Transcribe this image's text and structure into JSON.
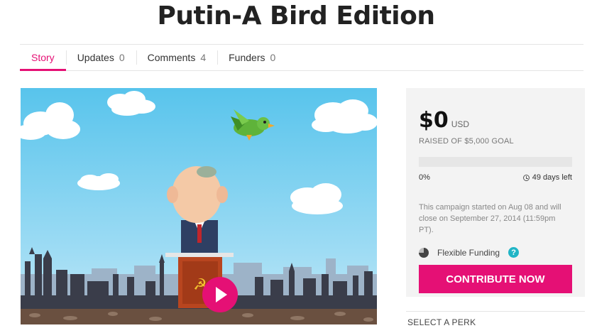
{
  "page": {
    "title": "Putin-A Bird Edition"
  },
  "tabs": [
    {
      "label": "Story",
      "count": ""
    },
    {
      "label": "Updates",
      "count": "0"
    },
    {
      "label": "Comments",
      "count": "4"
    },
    {
      "label": "Funders",
      "count": "0"
    }
  ],
  "video": {
    "play_icon": "play-icon",
    "progress_fraction": 0
  },
  "campaign": {
    "amount": "$0",
    "currency": "USD",
    "goal_text": "RAISED OF $5,000 GOAL",
    "progress_percent": 0,
    "percent_label": "0%",
    "days_left": "49 days left",
    "note": "This campaign started on Aug 08 and will close on September 27, 2014 (11:59pm PT).",
    "funding_type": "Flexible Funding",
    "help_glyph": "?",
    "contribute_label": "CONTRIBUTE NOW"
  },
  "perks": {
    "heading": "SELECT A PERK"
  },
  "colors": {
    "accent": "#e51075",
    "help": "#21b5c6"
  }
}
